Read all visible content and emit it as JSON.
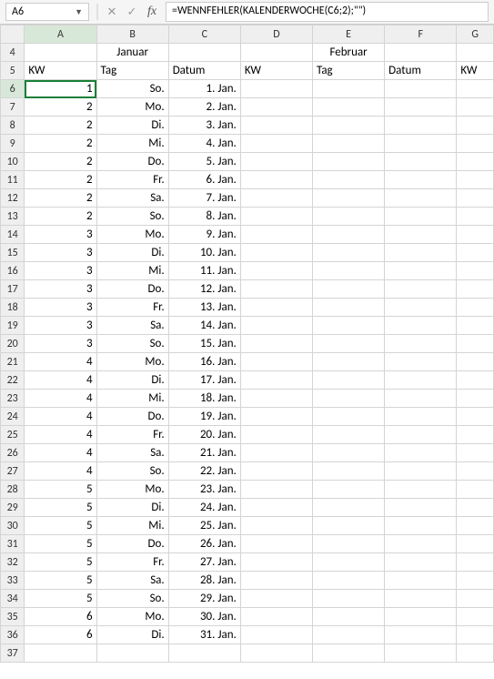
{
  "namebox": "A6",
  "formula": "=WENNFEHLER(KALENDERWOCHE(C6;2);\"\")",
  "colHeaders": [
    "A",
    "B",
    "C",
    "D",
    "E",
    "F",
    "G"
  ],
  "months": {
    "m1": "Januar",
    "m2": "Februar"
  },
  "headers": {
    "kw": "KW",
    "tag": "Tag",
    "datum": "Datum"
  },
  "rows": [
    {
      "n": 4,
      "A": "",
      "B": "Januar",
      "C": "",
      "D": "",
      "E": "Februar",
      "F": "",
      "G": ""
    },
    {
      "n": 5,
      "A": "KW",
      "B": "Tag",
      "C": "Datum",
      "D": "KW",
      "E": "Tag",
      "F": "Datum",
      "G": "KW"
    },
    {
      "n": 6,
      "A": "1",
      "B": "So.",
      "C": "1. Jan.",
      "D": "",
      "E": "",
      "F": "",
      "G": ""
    },
    {
      "n": 7,
      "A": "2",
      "B": "Mo.",
      "C": "2. Jan.",
      "D": "",
      "E": "",
      "F": "",
      "G": ""
    },
    {
      "n": 8,
      "A": "2",
      "B": "Di.",
      "C": "3. Jan.",
      "D": "",
      "E": "",
      "F": "",
      "G": ""
    },
    {
      "n": 9,
      "A": "2",
      "B": "Mi.",
      "C": "4. Jan.",
      "D": "",
      "E": "",
      "F": "",
      "G": ""
    },
    {
      "n": 10,
      "A": "2",
      "B": "Do.",
      "C": "5. Jan.",
      "D": "",
      "E": "",
      "F": "",
      "G": ""
    },
    {
      "n": 11,
      "A": "2",
      "B": "Fr.",
      "C": "6. Jan.",
      "D": "",
      "E": "",
      "F": "",
      "G": ""
    },
    {
      "n": 12,
      "A": "2",
      "B": "Sa.",
      "C": "7. Jan.",
      "D": "",
      "E": "",
      "F": "",
      "G": ""
    },
    {
      "n": 13,
      "A": "2",
      "B": "So.",
      "C": "8. Jan.",
      "D": "",
      "E": "",
      "F": "",
      "G": ""
    },
    {
      "n": 14,
      "A": "3",
      "B": "Mo.",
      "C": "9. Jan.",
      "D": "",
      "E": "",
      "F": "",
      "G": ""
    },
    {
      "n": 15,
      "A": "3",
      "B": "Di.",
      "C": "10. Jan.",
      "D": "",
      "E": "",
      "F": "",
      "G": ""
    },
    {
      "n": 16,
      "A": "3",
      "B": "Mi.",
      "C": "11. Jan.",
      "D": "",
      "E": "",
      "F": "",
      "G": ""
    },
    {
      "n": 17,
      "A": "3",
      "B": "Do.",
      "C": "12. Jan.",
      "D": "",
      "E": "",
      "F": "",
      "G": ""
    },
    {
      "n": 18,
      "A": "3",
      "B": "Fr.",
      "C": "13. Jan.",
      "D": "",
      "E": "",
      "F": "",
      "G": ""
    },
    {
      "n": 19,
      "A": "3",
      "B": "Sa.",
      "C": "14. Jan.",
      "D": "",
      "E": "",
      "F": "",
      "G": ""
    },
    {
      "n": 20,
      "A": "3",
      "B": "So.",
      "C": "15. Jan.",
      "D": "",
      "E": "",
      "F": "",
      "G": ""
    },
    {
      "n": 21,
      "A": "4",
      "B": "Mo.",
      "C": "16. Jan.",
      "D": "",
      "E": "",
      "F": "",
      "G": ""
    },
    {
      "n": 22,
      "A": "4",
      "B": "Di.",
      "C": "17. Jan.",
      "D": "",
      "E": "",
      "F": "",
      "G": ""
    },
    {
      "n": 23,
      "A": "4",
      "B": "Mi.",
      "C": "18. Jan.",
      "D": "",
      "E": "",
      "F": "",
      "G": ""
    },
    {
      "n": 24,
      "A": "4",
      "B": "Do.",
      "C": "19. Jan.",
      "D": "",
      "E": "",
      "F": "",
      "G": ""
    },
    {
      "n": 25,
      "A": "4",
      "B": "Fr.",
      "C": "20. Jan.",
      "D": "",
      "E": "",
      "F": "",
      "G": ""
    },
    {
      "n": 26,
      "A": "4",
      "B": "Sa.",
      "C": "21. Jan.",
      "D": "",
      "E": "",
      "F": "",
      "G": ""
    },
    {
      "n": 27,
      "A": "4",
      "B": "So.",
      "C": "22. Jan.",
      "D": "",
      "E": "",
      "F": "",
      "G": ""
    },
    {
      "n": 28,
      "A": "5",
      "B": "Mo.",
      "C": "23. Jan.",
      "D": "",
      "E": "",
      "F": "",
      "G": ""
    },
    {
      "n": 29,
      "A": "5",
      "B": "Di.",
      "C": "24. Jan.",
      "D": "",
      "E": "",
      "F": "",
      "G": ""
    },
    {
      "n": 30,
      "A": "5",
      "B": "Mi.",
      "C": "25. Jan.",
      "D": "",
      "E": "",
      "F": "",
      "G": ""
    },
    {
      "n": 31,
      "A": "5",
      "B": "Do.",
      "C": "26. Jan.",
      "D": "",
      "E": "",
      "F": "",
      "G": ""
    },
    {
      "n": 32,
      "A": "5",
      "B": "Fr.",
      "C": "27. Jan.",
      "D": "",
      "E": "",
      "F": "",
      "G": ""
    },
    {
      "n": 33,
      "A": "5",
      "B": "Sa.",
      "C": "28. Jan.",
      "D": "",
      "E": "",
      "F": "",
      "G": ""
    },
    {
      "n": 34,
      "A": "5",
      "B": "So.",
      "C": "29. Jan.",
      "D": "",
      "E": "",
      "F": "",
      "G": ""
    },
    {
      "n": 35,
      "A": "6",
      "B": "Mo.",
      "C": "30. Jan.",
      "D": "",
      "E": "",
      "F": "",
      "G": ""
    },
    {
      "n": 36,
      "A": "6",
      "B": "Di.",
      "C": "31. Jan.",
      "D": "",
      "E": "",
      "F": "",
      "G": ""
    },
    {
      "n": 37,
      "A": "",
      "B": "",
      "C": "",
      "D": "",
      "E": "",
      "F": "",
      "G": ""
    }
  ],
  "selectedCell": "A6"
}
